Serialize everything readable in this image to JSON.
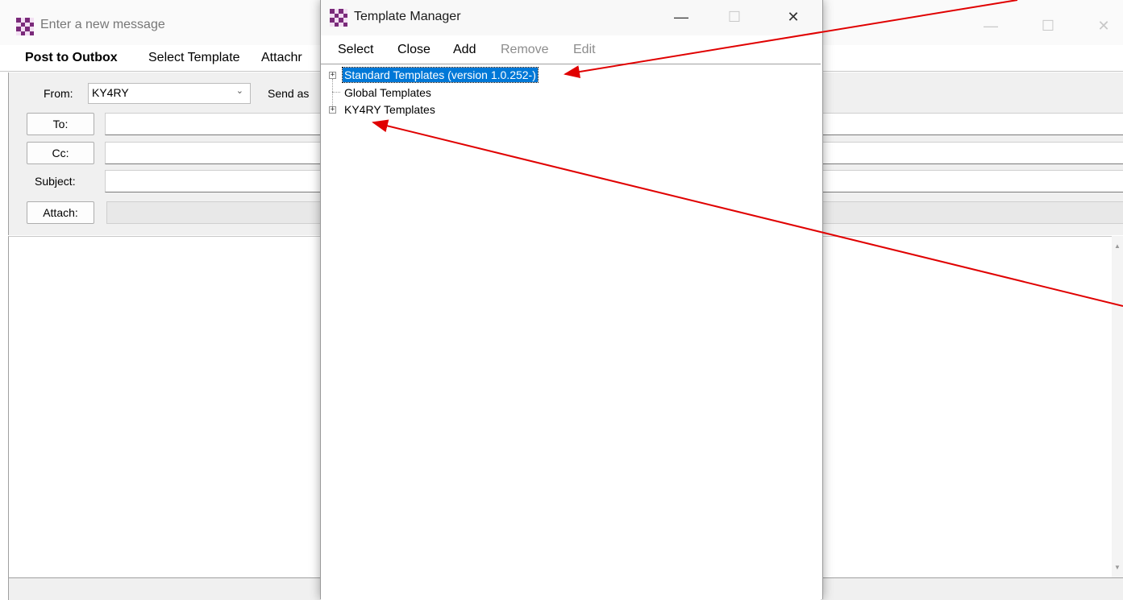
{
  "main_window": {
    "title": "Enter a new message",
    "menu": [
      "Post to Outbox",
      "Select Template",
      "Attachr"
    ],
    "from_label": "From:",
    "from_value": "KY4RY",
    "send_as_label": "Send as",
    "to_button": "To:",
    "cc_button": "Cc:",
    "subject_label": "Subject:",
    "attach_button": "Attach:"
  },
  "dialog": {
    "title": "Template Manager",
    "menu": [
      "Select",
      "Close",
      "Add",
      "Remove",
      "Edit"
    ],
    "tree": [
      {
        "label": "Standard Templates (version 1.0.252-)",
        "selected": true,
        "expandable": true
      },
      {
        "label": "Global Templates",
        "selected": false,
        "expandable": false
      },
      {
        "label": "KY4RY Templates",
        "selected": false,
        "expandable": true
      }
    ]
  },
  "window_controls": {
    "minimize": "—",
    "maximize": "☐",
    "close": "✕"
  },
  "colors": {
    "selection": "#0078d7",
    "annotation_arrow": "#e00000",
    "logo_purple": "#7a2a7a",
    "logo_light": "#f2dff2"
  }
}
